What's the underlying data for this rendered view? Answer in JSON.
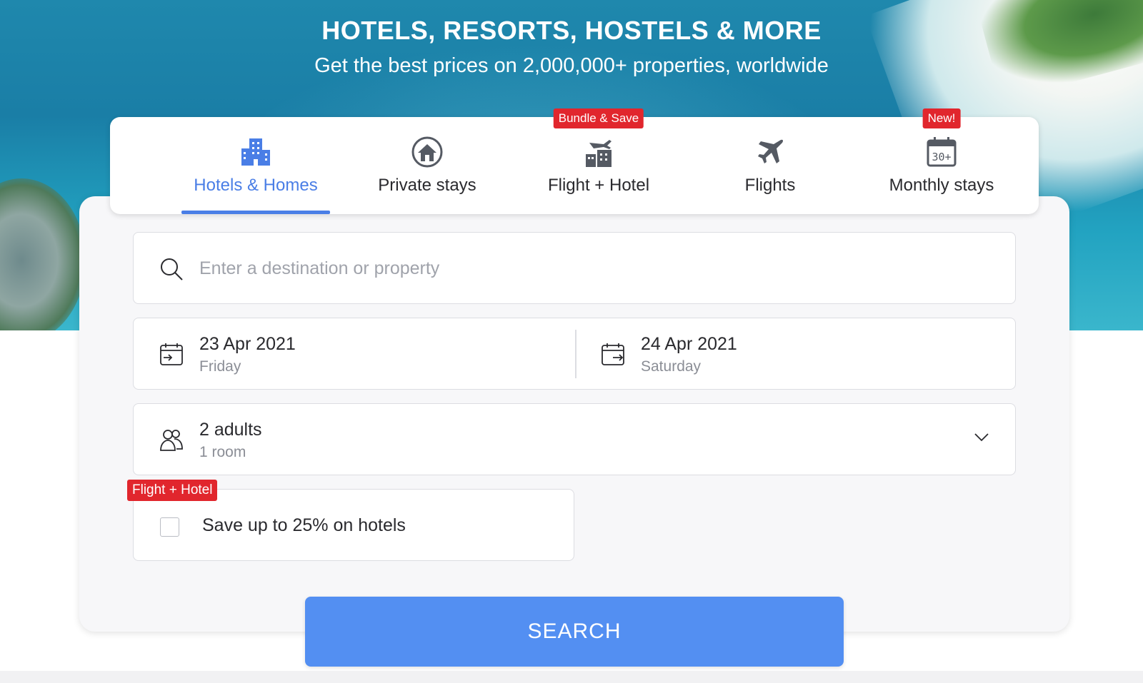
{
  "hero": {
    "headline": "HOTELS, RESORTS, HOSTELS & MORE",
    "subheadline": "Get the best prices on 2,000,000+ properties, worldwide"
  },
  "tabs": [
    {
      "label": "Hotels & Homes",
      "icon": "hotel-buildings-icon",
      "active": true,
      "badge": ""
    },
    {
      "label": "Private stays",
      "icon": "house-icon",
      "active": false,
      "badge": ""
    },
    {
      "label": "Flight + Hotel",
      "icon": "plane-hotel-icon",
      "active": false,
      "badge": "Bundle & Save"
    },
    {
      "label": "Flights",
      "icon": "plane-icon",
      "active": false,
      "badge": ""
    },
    {
      "label": "Monthly stays",
      "icon": "calendar-30-icon",
      "active": false,
      "badge": "New!"
    }
  ],
  "search": {
    "placeholder": "Enter a destination or property",
    "value": ""
  },
  "dates": {
    "checkin": {
      "date": "23 Apr 2021",
      "day": "Friday"
    },
    "checkout": {
      "date": "24 Apr 2021",
      "day": "Saturday"
    }
  },
  "guests": {
    "main": "2 adults",
    "sub": "1 room"
  },
  "bundle": {
    "badge": "Flight + Hotel",
    "label": "Save up to 25% on hotels",
    "checked": false
  },
  "search_button": {
    "label": "SEARCH"
  },
  "colors": {
    "accent": "#4a7ee6",
    "button": "#538ff2",
    "badge": "#e1262d",
    "icon_gray": "#555a63"
  }
}
